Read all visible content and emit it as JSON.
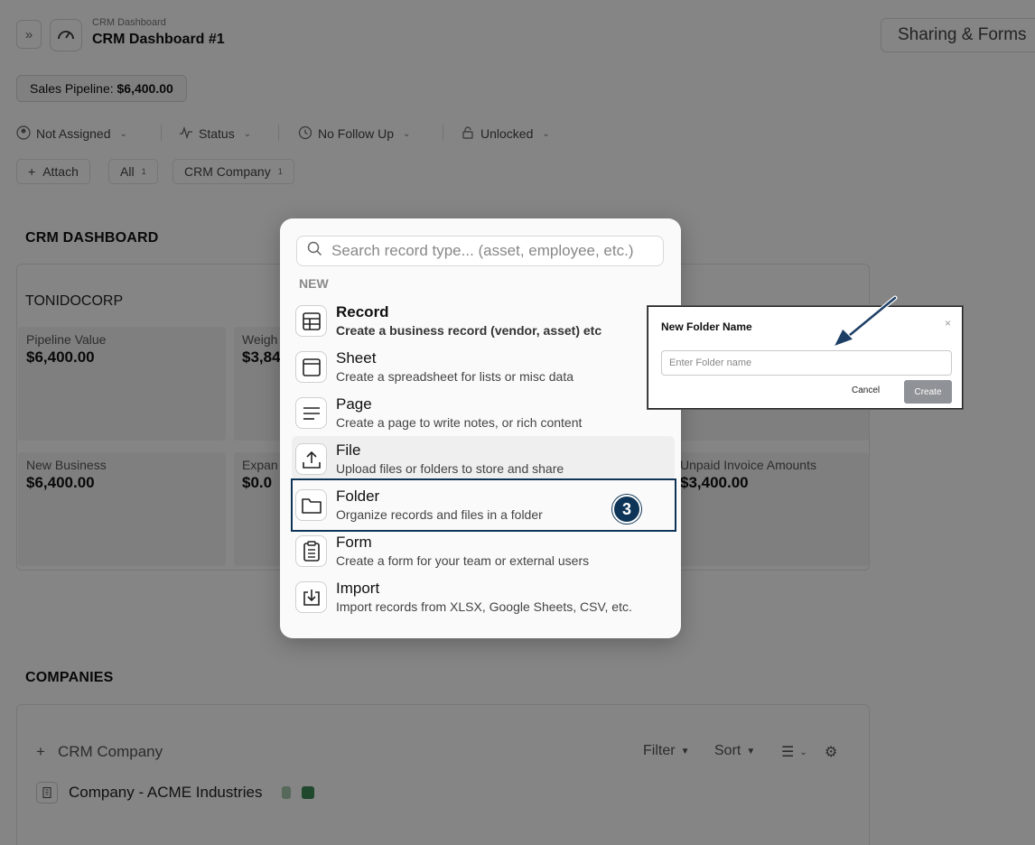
{
  "header": {
    "breadcrumb": "CRM Dashboard",
    "title": "CRM Dashboard #1",
    "share_label": "Sharing & Forms"
  },
  "pipeline_chip": {
    "label": "Sales Pipeline:",
    "value": "$6,400.00"
  },
  "filters": [
    {
      "label": "Not Assigned"
    },
    {
      "label": "Status"
    },
    {
      "label": "No Follow Up"
    },
    {
      "label": "Unlocked"
    }
  ],
  "tabs": {
    "attach": "Attach",
    "all": {
      "label": "All",
      "count": "1"
    },
    "crm_company": {
      "label": "CRM Company",
      "count": "1"
    }
  },
  "dashboard": {
    "section_title": "CRM DASHBOARD",
    "company": "TONIDOCORP",
    "cards": [
      {
        "label": "Pipeline Value",
        "value": "$6,400.00"
      },
      {
        "label": "Weigh",
        "value": "$3,84"
      },
      {
        "label": "New Business",
        "value": "$6,400.00"
      },
      {
        "label": "Expan",
        "value": "$0.0"
      },
      {
        "label": "Unpaid Invoice Amounts",
        "value": "$3,400.00"
      }
    ]
  },
  "companies": {
    "section_title": "COMPANIES",
    "add_label": "CRM Company",
    "filter_label": "Filter",
    "sort_label": "Sort",
    "rows": [
      {
        "name": "Company - ACME Industries"
      }
    ]
  },
  "menu": {
    "search_placeholder": "Search record type... (asset, employee, etc.)",
    "section_label": "NEW",
    "items": [
      {
        "title": "Record",
        "desc": "Create a business record (vendor, asset) etc",
        "icon": "table-icon"
      },
      {
        "title": "Sheet",
        "desc": "Create a spreadsheet for lists or misc data",
        "icon": "sheet-icon"
      },
      {
        "title": "Page",
        "desc": "Create a page to write notes, or rich content",
        "icon": "page-lines-icon"
      },
      {
        "title": "File",
        "desc": "Upload files or folders to store and share",
        "icon": "upload-icon"
      },
      {
        "title": "Folder",
        "desc": "Organize records and files in a folder",
        "icon": "folder-icon"
      },
      {
        "title": "Form",
        "desc": "Create a form for your team or external users",
        "icon": "clipboard-icon"
      },
      {
        "title": "Import",
        "desc": "Import records from XLSX, Google Sheets, CSV, etc.",
        "icon": "import-icon"
      }
    ],
    "step_number": "3"
  },
  "dialog": {
    "title": "New Folder Name",
    "close": "×",
    "input_placeholder": "Enter Folder name",
    "input_value": "",
    "cancel_label": "Cancel",
    "create_label": "Create"
  },
  "colors": {
    "accent_navy": "#0e3557",
    "create_button": "#8f9296",
    "card_bg": "#f1f4f1"
  }
}
